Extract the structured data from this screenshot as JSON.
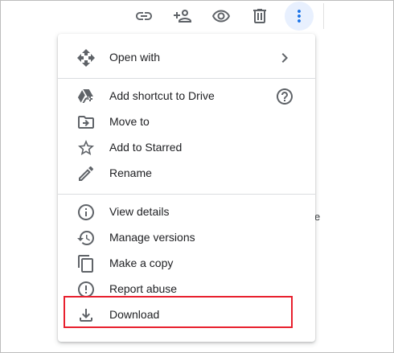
{
  "toolbar": {
    "icons": [
      "link-icon",
      "add-person-icon",
      "eye-icon",
      "trash-icon",
      "more-vert-icon"
    ],
    "accent_color": "#1a73e8"
  },
  "background": {
    "fragment_text": "e"
  },
  "menu": {
    "items": [
      {
        "label": "Open with",
        "icon": "open-with-icon",
        "right": "chevron-right-icon"
      },
      {
        "label": "Add shortcut to Drive",
        "icon": "drive-add-icon",
        "right": "help-icon"
      },
      {
        "label": "Move to",
        "icon": "move-to-folder-icon"
      },
      {
        "label": "Add to Starred",
        "icon": "star-icon"
      },
      {
        "label": "Rename",
        "icon": "pencil-icon"
      },
      {
        "label": "View details",
        "icon": "info-icon"
      },
      {
        "label": "Manage versions",
        "icon": "history-icon"
      },
      {
        "label": "Make a copy",
        "icon": "copy-icon"
      },
      {
        "label": "Report abuse",
        "icon": "report-icon"
      },
      {
        "label": "Download",
        "icon": "download-icon"
      }
    ],
    "highlight_color": "#e8202e"
  }
}
